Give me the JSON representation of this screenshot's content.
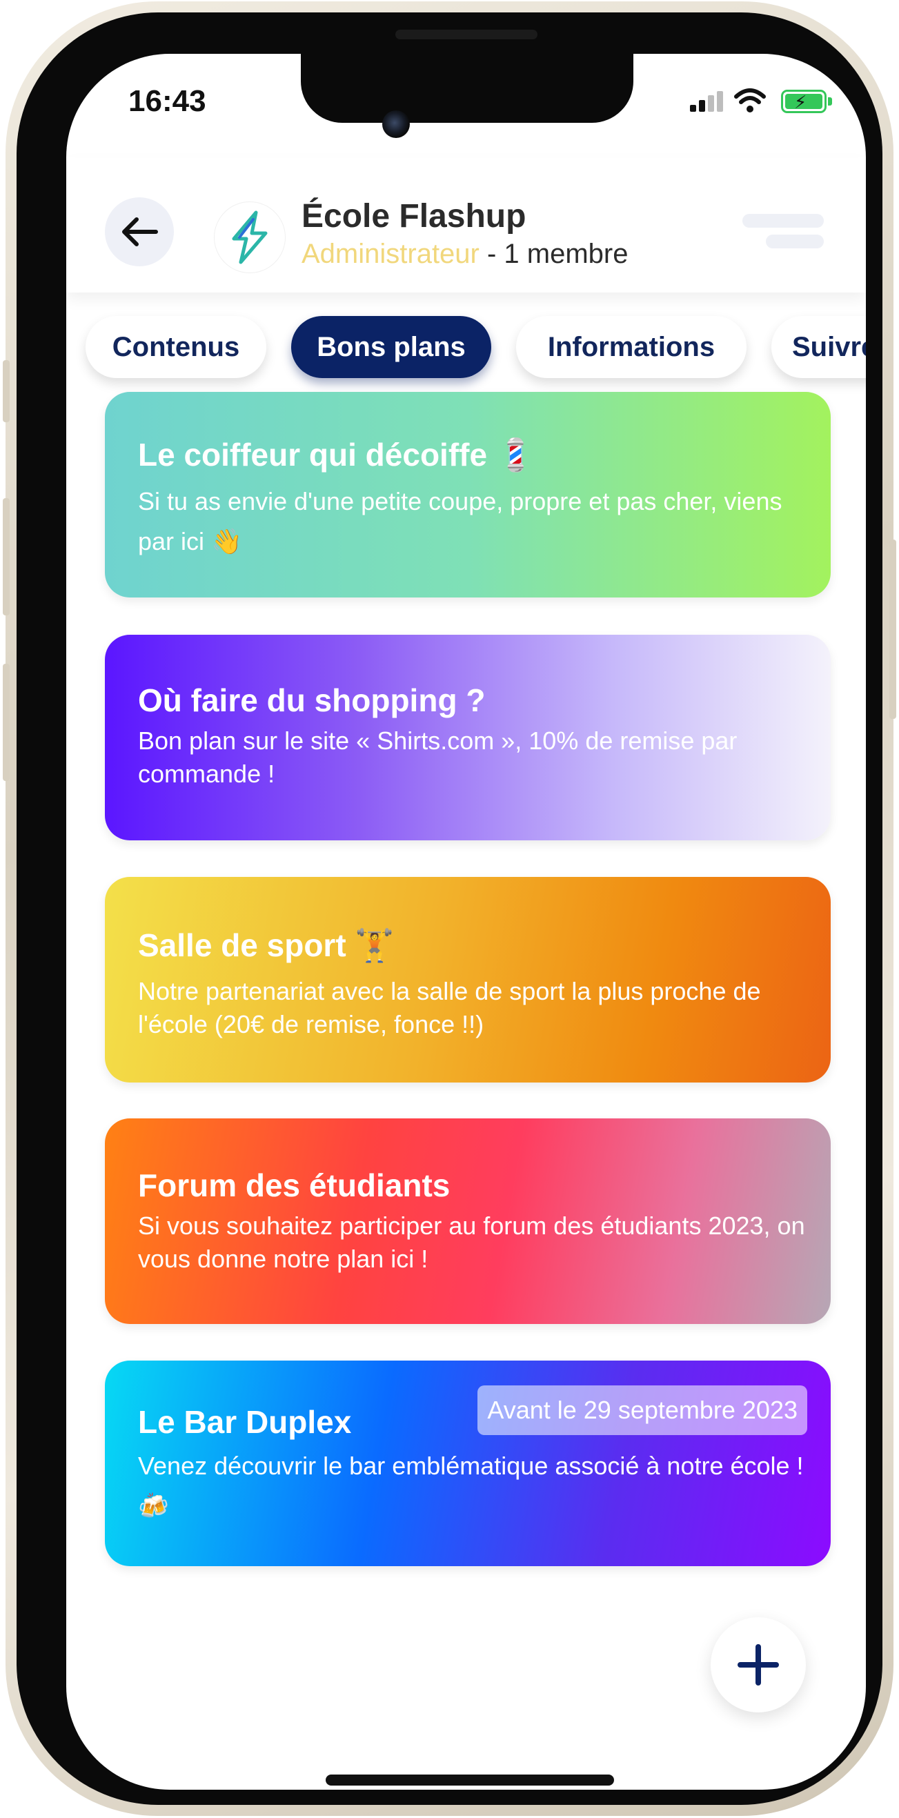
{
  "status_bar": {
    "time": "16:43"
  },
  "header": {
    "school_name": "École Flashup",
    "role": "Administrateur",
    "members": " - 1 membre"
  },
  "tabs": [
    {
      "label": "Contenus",
      "active": false
    },
    {
      "label": "Bons plans",
      "active": true
    },
    {
      "label": "Informations",
      "active": false
    },
    {
      "label": "Suivre",
      "active": false
    }
  ],
  "cards": [
    {
      "title": "Le coiffeur qui décoiffe 💈",
      "description": "Si tu as envie d'une petite coupe, propre et pas cher, viens par ici 👋"
    },
    {
      "title": "Où faire du shopping ?",
      "description": "Bon plan sur le site « Shirts.com », 10% de remise par commande !"
    },
    {
      "title": "Salle de sport 🏋️",
      "description": "Notre partenariat avec la salle de sport la plus proche de l'école (20€ de remise, fonce !!)"
    },
    {
      "title": "Forum des étudiants",
      "description": "Si vous souhaitez participer au forum des étudiants 2023, on vous donne notre plan ici !"
    },
    {
      "title": "Le Bar Duplex",
      "description": "Venez découvrir le bar emblématique associé à notre école ! 🍻",
      "date": "Avant le 29 septembre 2023"
    }
  ],
  "colors": {
    "accent_navy": "#0b2366",
    "role_gold": "#f1d77c",
    "card1": [
      "#6fd3cf",
      "#a3f25e"
    ],
    "card2": [
      "#5b16ff",
      "#f4f2fb"
    ],
    "card3": [
      "#f3e04a",
      "#ed6c12"
    ],
    "card4": [
      "#ff7e15",
      "#ff3d5e",
      "#b6a7b5"
    ],
    "card5": [
      "#07d9f4",
      "#0a5cff",
      "#8c0bff"
    ]
  },
  "icons": {
    "back": "arrow-left-icon",
    "logo": "lightning-bolt-logo",
    "menu": "menu-lines-icon",
    "add": "plus-icon"
  }
}
